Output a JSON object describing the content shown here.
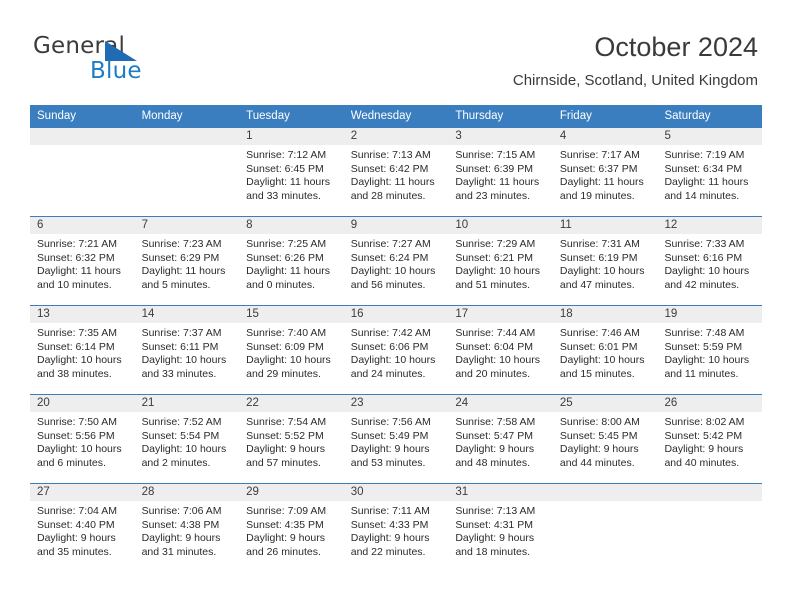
{
  "brand": {
    "name_top": "General",
    "name_bottom": "Blue",
    "accent_color": "#1f7bc4",
    "triangle_color": "#1f6cb4"
  },
  "header": {
    "title": "October 2024",
    "subtitle": "Chirnside, Scotland, United Kingdom"
  },
  "theme": {
    "header_band": "#3a7ec0",
    "daynum_band": "#eeeeee",
    "text": "#2b2b2b"
  },
  "weekdays": [
    "Sunday",
    "Monday",
    "Tuesday",
    "Wednesday",
    "Thursday",
    "Friday",
    "Saturday"
  ],
  "weeks": [
    [
      {
        "day": "",
        "sunrise": "",
        "sunset": "",
        "daylight_line1": "",
        "daylight_line2": ""
      },
      {
        "day": "",
        "sunrise": "",
        "sunset": "",
        "daylight_line1": "",
        "daylight_line2": ""
      },
      {
        "day": "1",
        "sunrise": "Sunrise: 7:12 AM",
        "sunset": "Sunset: 6:45 PM",
        "daylight_line1": "Daylight: 11 hours",
        "daylight_line2": "and 33 minutes."
      },
      {
        "day": "2",
        "sunrise": "Sunrise: 7:13 AM",
        "sunset": "Sunset: 6:42 PM",
        "daylight_line1": "Daylight: 11 hours",
        "daylight_line2": "and 28 minutes."
      },
      {
        "day": "3",
        "sunrise": "Sunrise: 7:15 AM",
        "sunset": "Sunset: 6:39 PM",
        "daylight_line1": "Daylight: 11 hours",
        "daylight_line2": "and 23 minutes."
      },
      {
        "day": "4",
        "sunrise": "Sunrise: 7:17 AM",
        "sunset": "Sunset: 6:37 PM",
        "daylight_line1": "Daylight: 11 hours",
        "daylight_line2": "and 19 minutes."
      },
      {
        "day": "5",
        "sunrise": "Sunrise: 7:19 AM",
        "sunset": "Sunset: 6:34 PM",
        "daylight_line1": "Daylight: 11 hours",
        "daylight_line2": "and 14 minutes."
      }
    ],
    [
      {
        "day": "6",
        "sunrise": "Sunrise: 7:21 AM",
        "sunset": "Sunset: 6:32 PM",
        "daylight_line1": "Daylight: 11 hours",
        "daylight_line2": "and 10 minutes."
      },
      {
        "day": "7",
        "sunrise": "Sunrise: 7:23 AM",
        "sunset": "Sunset: 6:29 PM",
        "daylight_line1": "Daylight: 11 hours",
        "daylight_line2": "and 5 minutes."
      },
      {
        "day": "8",
        "sunrise": "Sunrise: 7:25 AM",
        "sunset": "Sunset: 6:26 PM",
        "daylight_line1": "Daylight: 11 hours",
        "daylight_line2": "and 0 minutes."
      },
      {
        "day": "9",
        "sunrise": "Sunrise: 7:27 AM",
        "sunset": "Sunset: 6:24 PM",
        "daylight_line1": "Daylight: 10 hours",
        "daylight_line2": "and 56 minutes."
      },
      {
        "day": "10",
        "sunrise": "Sunrise: 7:29 AM",
        "sunset": "Sunset: 6:21 PM",
        "daylight_line1": "Daylight: 10 hours",
        "daylight_line2": "and 51 minutes."
      },
      {
        "day": "11",
        "sunrise": "Sunrise: 7:31 AM",
        "sunset": "Sunset: 6:19 PM",
        "daylight_line1": "Daylight: 10 hours",
        "daylight_line2": "and 47 minutes."
      },
      {
        "day": "12",
        "sunrise": "Sunrise: 7:33 AM",
        "sunset": "Sunset: 6:16 PM",
        "daylight_line1": "Daylight: 10 hours",
        "daylight_line2": "and 42 minutes."
      }
    ],
    [
      {
        "day": "13",
        "sunrise": "Sunrise: 7:35 AM",
        "sunset": "Sunset: 6:14 PM",
        "daylight_line1": "Daylight: 10 hours",
        "daylight_line2": "and 38 minutes."
      },
      {
        "day": "14",
        "sunrise": "Sunrise: 7:37 AM",
        "sunset": "Sunset: 6:11 PM",
        "daylight_line1": "Daylight: 10 hours",
        "daylight_line2": "and 33 minutes."
      },
      {
        "day": "15",
        "sunrise": "Sunrise: 7:40 AM",
        "sunset": "Sunset: 6:09 PM",
        "daylight_line1": "Daylight: 10 hours",
        "daylight_line2": "and 29 minutes."
      },
      {
        "day": "16",
        "sunrise": "Sunrise: 7:42 AM",
        "sunset": "Sunset: 6:06 PM",
        "daylight_line1": "Daylight: 10 hours",
        "daylight_line2": "and 24 minutes."
      },
      {
        "day": "17",
        "sunrise": "Sunrise: 7:44 AM",
        "sunset": "Sunset: 6:04 PM",
        "daylight_line1": "Daylight: 10 hours",
        "daylight_line2": "and 20 minutes."
      },
      {
        "day": "18",
        "sunrise": "Sunrise: 7:46 AM",
        "sunset": "Sunset: 6:01 PM",
        "daylight_line1": "Daylight: 10 hours",
        "daylight_line2": "and 15 minutes."
      },
      {
        "day": "19",
        "sunrise": "Sunrise: 7:48 AM",
        "sunset": "Sunset: 5:59 PM",
        "daylight_line1": "Daylight: 10 hours",
        "daylight_line2": "and 11 minutes."
      }
    ],
    [
      {
        "day": "20",
        "sunrise": "Sunrise: 7:50 AM",
        "sunset": "Sunset: 5:56 PM",
        "daylight_line1": "Daylight: 10 hours",
        "daylight_line2": "and 6 minutes."
      },
      {
        "day": "21",
        "sunrise": "Sunrise: 7:52 AM",
        "sunset": "Sunset: 5:54 PM",
        "daylight_line1": "Daylight: 10 hours",
        "daylight_line2": "and 2 minutes."
      },
      {
        "day": "22",
        "sunrise": "Sunrise: 7:54 AM",
        "sunset": "Sunset: 5:52 PM",
        "daylight_line1": "Daylight: 9 hours",
        "daylight_line2": "and 57 minutes."
      },
      {
        "day": "23",
        "sunrise": "Sunrise: 7:56 AM",
        "sunset": "Sunset: 5:49 PM",
        "daylight_line1": "Daylight: 9 hours",
        "daylight_line2": "and 53 minutes."
      },
      {
        "day": "24",
        "sunrise": "Sunrise: 7:58 AM",
        "sunset": "Sunset: 5:47 PM",
        "daylight_line1": "Daylight: 9 hours",
        "daylight_line2": "and 48 minutes."
      },
      {
        "day": "25",
        "sunrise": "Sunrise: 8:00 AM",
        "sunset": "Sunset: 5:45 PM",
        "daylight_line1": "Daylight: 9 hours",
        "daylight_line2": "and 44 minutes."
      },
      {
        "day": "26",
        "sunrise": "Sunrise: 8:02 AM",
        "sunset": "Sunset: 5:42 PM",
        "daylight_line1": "Daylight: 9 hours",
        "daylight_line2": "and 40 minutes."
      }
    ],
    [
      {
        "day": "27",
        "sunrise": "Sunrise: 7:04 AM",
        "sunset": "Sunset: 4:40 PM",
        "daylight_line1": "Daylight: 9 hours",
        "daylight_line2": "and 35 minutes."
      },
      {
        "day": "28",
        "sunrise": "Sunrise: 7:06 AM",
        "sunset": "Sunset: 4:38 PM",
        "daylight_line1": "Daylight: 9 hours",
        "daylight_line2": "and 31 minutes."
      },
      {
        "day": "29",
        "sunrise": "Sunrise: 7:09 AM",
        "sunset": "Sunset: 4:35 PM",
        "daylight_line1": "Daylight: 9 hours",
        "daylight_line2": "and 26 minutes."
      },
      {
        "day": "30",
        "sunrise": "Sunrise: 7:11 AM",
        "sunset": "Sunset: 4:33 PM",
        "daylight_line1": "Daylight: 9 hours",
        "daylight_line2": "and 22 minutes."
      },
      {
        "day": "31",
        "sunrise": "Sunrise: 7:13 AM",
        "sunset": "Sunset: 4:31 PM",
        "daylight_line1": "Daylight: 9 hours",
        "daylight_line2": "and 18 minutes."
      },
      {
        "day": "",
        "sunrise": "",
        "sunset": "",
        "daylight_line1": "",
        "daylight_line2": ""
      },
      {
        "day": "",
        "sunrise": "",
        "sunset": "",
        "daylight_line1": "",
        "daylight_line2": ""
      }
    ]
  ]
}
